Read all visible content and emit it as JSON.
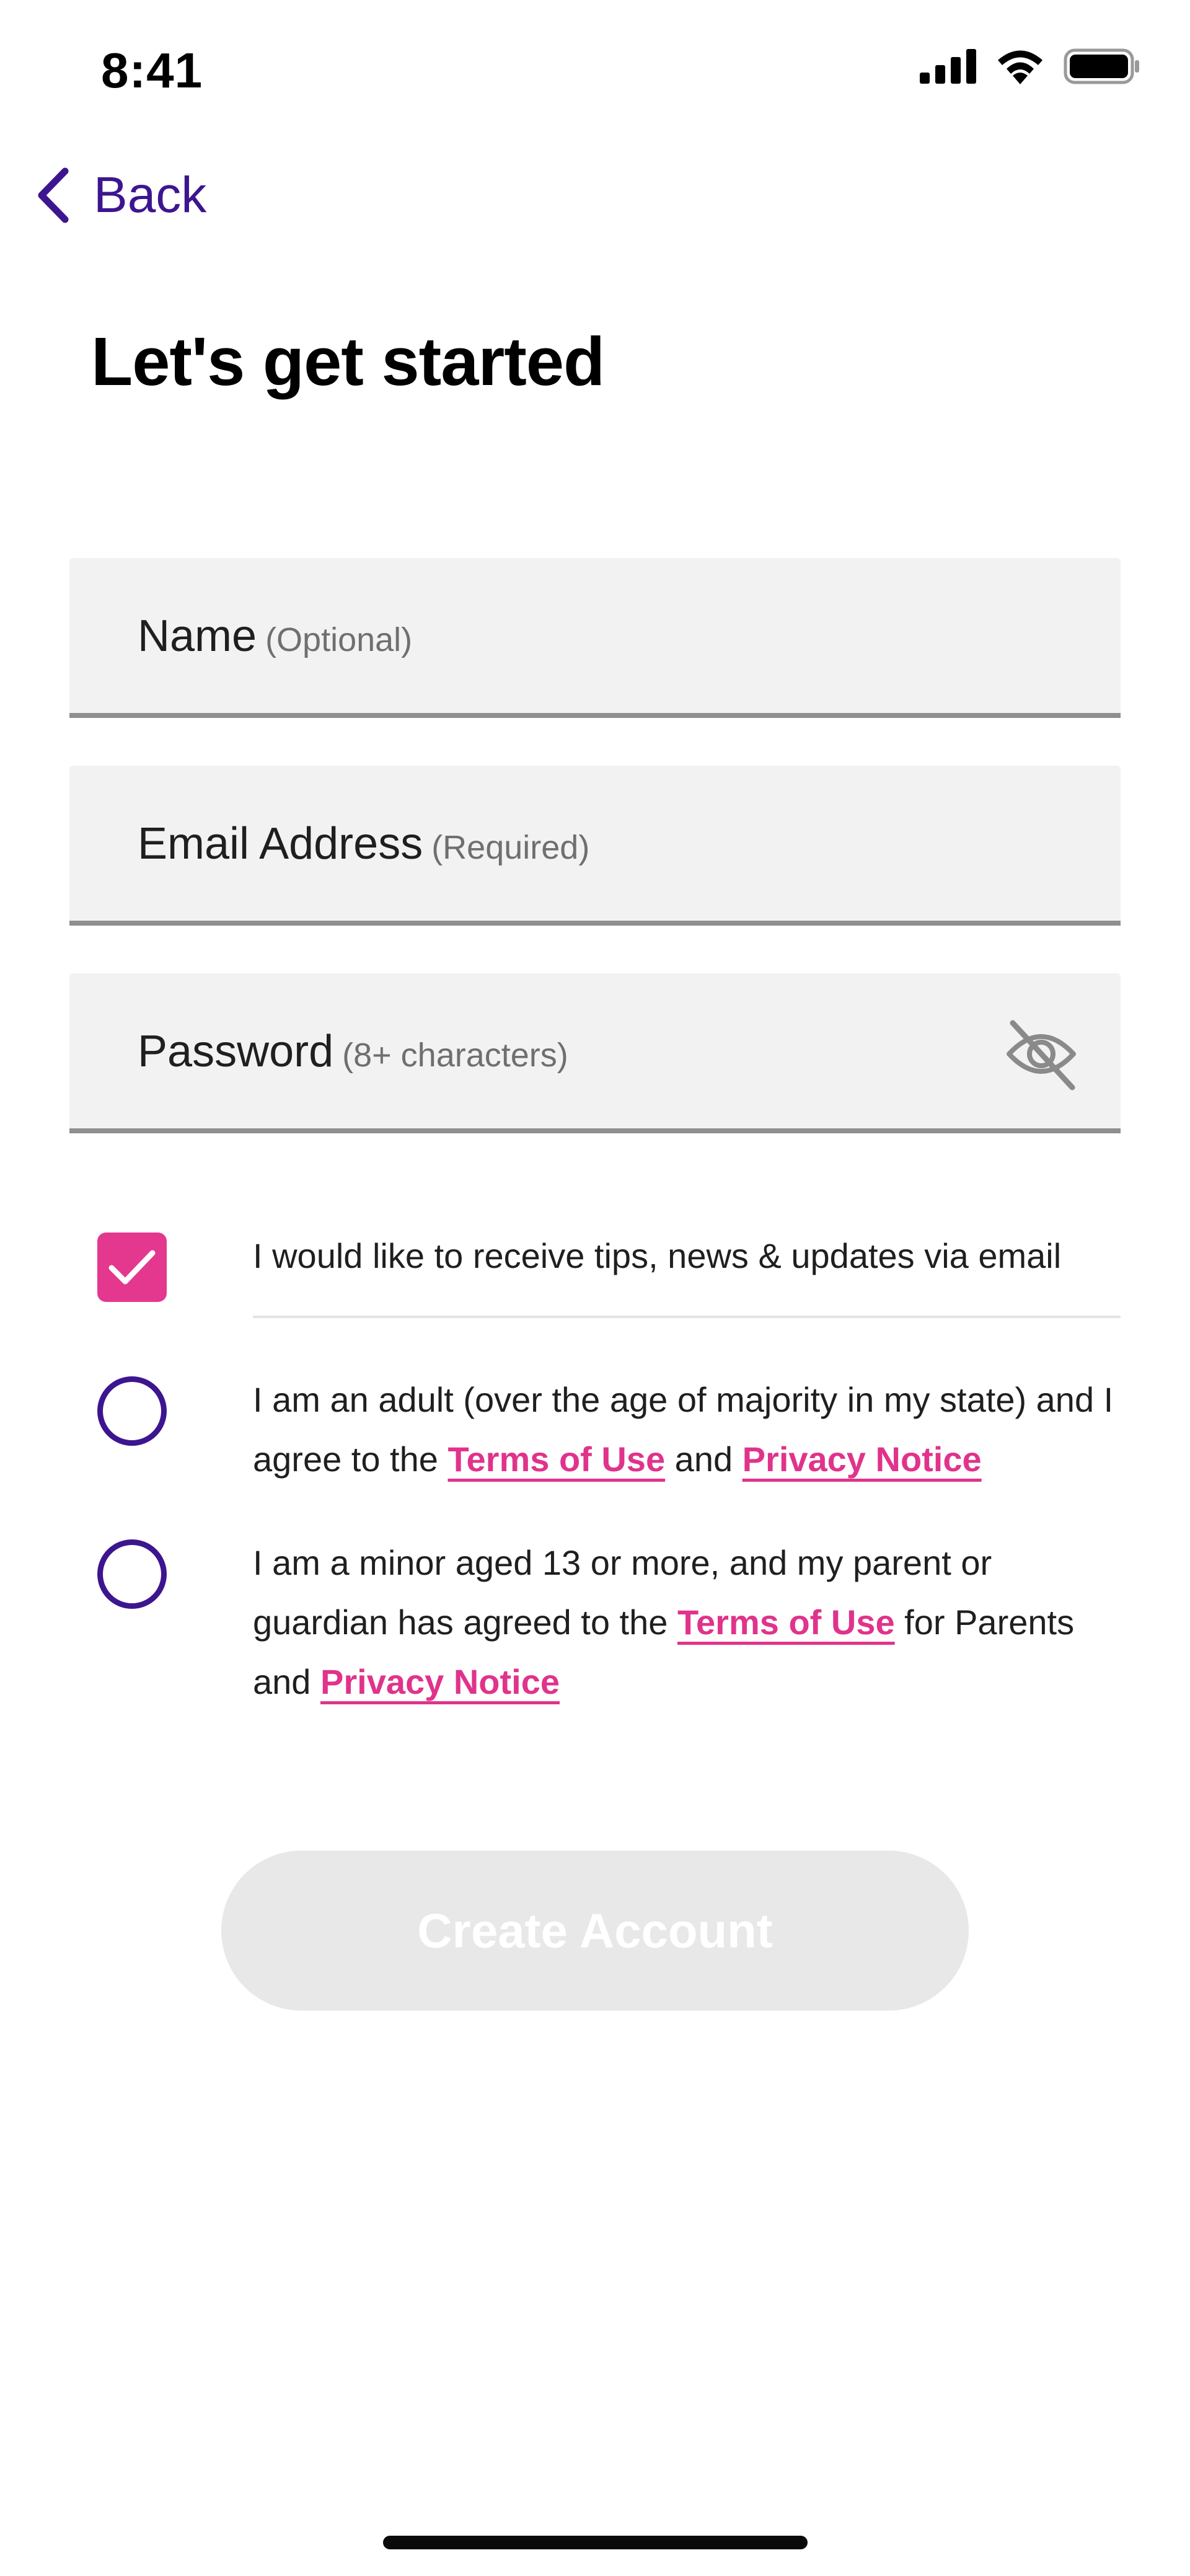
{
  "status_bar": {
    "time": "8:41",
    "icons": [
      "cellular-signal-icon",
      "wifi-icon",
      "battery-icon"
    ]
  },
  "nav": {
    "back_label": "Back",
    "back_icon": "chevron-left-icon"
  },
  "title": "Let's get started",
  "form": {
    "name": {
      "label": "Name",
      "hint": "(Optional)",
      "value": ""
    },
    "email": {
      "label": "Email Address",
      "hint": "(Required)",
      "value": ""
    },
    "password": {
      "label": "Password",
      "hint": "(8+ characters)",
      "value": "",
      "toggle_icon": "eye-off-icon"
    }
  },
  "options": {
    "marketing": {
      "text": "I would like to receive tips, news & updates via email",
      "checked": true
    },
    "adult": {
      "text_1": "I am an adult (over the age of majority in my state) and I agree to the",
      "terms_link": "Terms of Use",
      "and": "and",
      "privacy_link": "Privacy Notice",
      "selected": false
    },
    "minor": {
      "text_1": "I am a minor aged 13 or more, and my parent or guardian has agreed to the",
      "terms_link": "Terms of Use",
      "text_2": "for Parents and",
      "privacy_link": "Privacy Notice",
      "selected": false
    }
  },
  "create_button": {
    "label": "Create Account",
    "enabled": false
  },
  "colors": {
    "accent_purple": "#3d158f",
    "accent_pink": "#e4388f",
    "field_bg": "#f2f2f2",
    "button_disabled": "#e8e8e8"
  }
}
